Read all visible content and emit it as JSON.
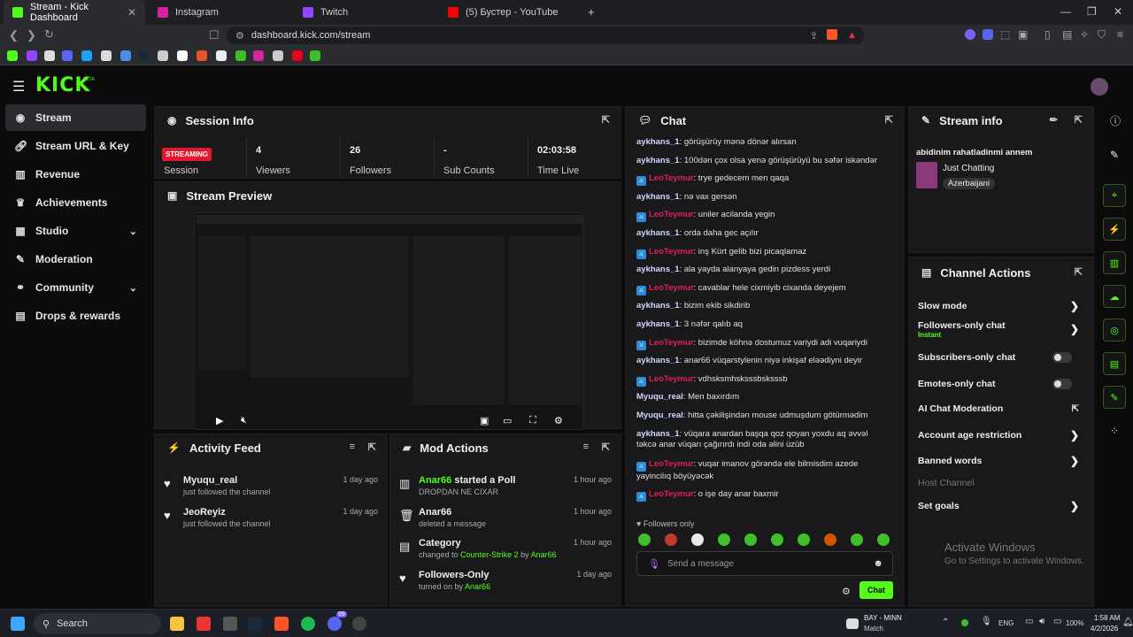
{
  "browser": {
    "tabs": [
      {
        "title": "Stream - Kick Dashboard",
        "color": "#53fc18"
      },
      {
        "title": "Instagram",
        "color": "#d6249f"
      },
      {
        "title": "Twitch",
        "color": "#9146ff"
      },
      {
        "title": "(5) Бустер - YouTube",
        "color": "#ff0000"
      }
    ],
    "url": "dashboard.kick.com/stream"
  },
  "app": {
    "logo": "KICK",
    "logo_beta": "BETA",
    "nav": [
      {
        "label": "Stream",
        "icon": "stream-icon"
      },
      {
        "label": "Stream URL & Key",
        "icon": "link-icon"
      },
      {
        "label": "Revenue",
        "icon": "revenue-icon"
      },
      {
        "label": "Achievements",
        "icon": "trophy-icon"
      },
      {
        "label": "Studio",
        "icon": "studio-icon"
      },
      {
        "label": "Moderation",
        "icon": "wrench-icon"
      },
      {
        "label": "Community",
        "icon": "community-icon"
      },
      {
        "label": "Drops & rewards",
        "icon": "drops-icon"
      }
    ]
  },
  "session": {
    "title": "Session Info",
    "badge": "STREAMING",
    "stats": [
      {
        "value": "",
        "label": "Session"
      },
      {
        "value": "4",
        "label": "Viewers"
      },
      {
        "value": "26",
        "label": "Followers"
      },
      {
        "value": "-",
        "label": "Sub Counts"
      },
      {
        "value": "02:03:58",
        "label": "Time Live"
      }
    ]
  },
  "preview": {
    "title": "Stream Preview"
  },
  "activity": {
    "title": "Activity Feed",
    "items": [
      {
        "name": "Myuqu_real",
        "desc": "just followed the channel",
        "time": "1 day ago"
      },
      {
        "name": "JeoReyiz",
        "desc": "just followed the channel",
        "time": "1 day ago"
      }
    ]
  },
  "modactions": {
    "title": "Mod Actions",
    "items": [
      {
        "title_a": "Anar66",
        "title_b": " started a Poll",
        "desc": "DROPDAN NE CIXAR",
        "time": "1 hour ago"
      },
      {
        "title_a": "Anar66",
        "title_b": "",
        "desc": "deleted a message",
        "time": "1 hour ago"
      },
      {
        "title_a": "Category",
        "title_b": "",
        "desc_a": "changed to ",
        "desc_b": "Counter-Strike 2",
        "desc_c": " by ",
        "desc_d": "Anar66",
        "time": "1 hour ago"
      },
      {
        "title_a": "Followers-Only",
        "title_b": "",
        "desc_a": "turned on by ",
        "desc_b": "Anar66",
        "time": "1 day ago"
      }
    ]
  },
  "chat": {
    "title": "Chat",
    "messages": [
      {
        "user": "aykhans_1",
        "mod": false,
        "text": "görüşürüy mənə dönər alırsan"
      },
      {
        "user": "aykhans_1",
        "mod": false,
        "text": "100dən çox olsa yenə görüşürüyü bu səfər iskəndər"
      },
      {
        "user": "LeoTeymur",
        "mod": true,
        "text": "trye gedecem men qaqa"
      },
      {
        "user": "aykhans_1",
        "mod": false,
        "text": "nə vax gersən"
      },
      {
        "user": "LeoTeymur",
        "mod": true,
        "text": "uniler acilanda yegin"
      },
      {
        "user": "aykhans_1",
        "mod": false,
        "text": "orda daha gec açılır"
      },
      {
        "user": "LeoTeymur",
        "mod": true,
        "text": "inş Kürt gelib bizi picaqlamaz"
      },
      {
        "user": "aykhans_1",
        "mod": false,
        "text": "ala yayda alanyaya gedin pizdess yerdi"
      },
      {
        "user": "LeoTeymur",
        "mod": true,
        "text": "cavablar hele cixmiyib cixanda deyejem"
      },
      {
        "user": "aykhans_1",
        "mod": false,
        "text": "bizim ekib sikdirib"
      },
      {
        "user": "aykhans_1",
        "mod": false,
        "text": "3 nəfər qalıb aq"
      },
      {
        "user": "LeoTeymur",
        "mod": true,
        "text": "bizimde köhnə dostumuz variydi adi vuqariydi"
      },
      {
        "user": "aykhans_1",
        "mod": false,
        "text": "anar66 vüqarstylenin niyə inkişaf eləədiyni deyir"
      },
      {
        "user": "LeoTeymur",
        "mod": true,
        "text": "vdhsksmhsksssbsksssb"
      },
      {
        "user": "Myuqu_real",
        "mod": false,
        "text": "Men baxırdım"
      },
      {
        "user": "Myuqu_real",
        "mod": false,
        "text": "hitta çəkilişindən mouse udmuşdum götürmədim"
      },
      {
        "user": "aykhans_1",
        "mod": false,
        "text": "vüqara anardan başqa qoz qoyan yoxdu aq əvvəl təkcə anar vüqarı çağırırdı indi oda əlini üzüb"
      },
      {
        "user": "LeoTeymur",
        "mod": true,
        "text": "vuqar imanov görəndə ele bilmisdim azede yayincilıq böyüyəcək"
      },
      {
        "user": "LeoTeymur",
        "mod": true,
        "text": "o işe day anar baxmir"
      }
    ],
    "followers_only": "Followers only",
    "input_placeholder": "Send a message",
    "send_label": "Chat"
  },
  "streaminfo": {
    "title": "Stream info",
    "stream_title": "abidinim rahatladinmi annem",
    "category": "Just Chatting",
    "tag": "Azerbaijani"
  },
  "channelactions": {
    "title": "Channel Actions",
    "items": [
      {
        "label": "Slow mode",
        "sub": "",
        "control": "arrow"
      },
      {
        "label": "Followers-only chat",
        "sub": "Instant",
        "control": "arrow"
      },
      {
        "label": "Subscribers-only chat",
        "sub": "",
        "control": "toggle"
      },
      {
        "label": "Emotes-only chat",
        "sub": "",
        "control": "toggle"
      },
      {
        "label": "AI Chat Moderation",
        "sub": "",
        "control": "external"
      },
      {
        "label": "Account age restriction",
        "sub": "",
        "control": "arrow"
      },
      {
        "label": "Banned words",
        "sub": "",
        "control": "arrow"
      },
      {
        "label": "Host Channel",
        "sub": "",
        "control": "none"
      },
      {
        "label": "Set goals",
        "sub": "",
        "control": "arrow"
      }
    ]
  },
  "watermark": {
    "line1": "Activate Windows",
    "line2": "Go to Settings to activate Windows."
  },
  "taskbar": {
    "search": "Search",
    "weather_a": "BAY - MINN",
    "weather_b": "Match",
    "lang": "ENG",
    "battery": "100%",
    "time": "1:58 AM",
    "date": "4/2/2026",
    "badge_count": "99"
  },
  "colors": {
    "accent": "#53fc18",
    "mod_name": "#e01e5a",
    "streaming": "#e6162d"
  }
}
